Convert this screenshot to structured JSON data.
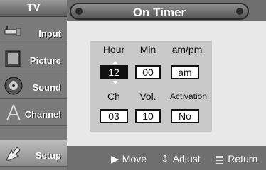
{
  "top": {
    "tab": "TV",
    "title": "On Timer"
  },
  "sidebar": {
    "items": [
      {
        "label": "Input",
        "icon": "input-icon"
      },
      {
        "label": "Picture",
        "icon": "picture-icon"
      },
      {
        "label": "Sound",
        "icon": "sound-icon"
      },
      {
        "label": "Channel",
        "icon": "channel-icon"
      },
      {
        "label": "Setup",
        "icon": "setup-icon"
      }
    ],
    "active": "Setup"
  },
  "timer": {
    "headers_row1": [
      "Hour",
      "Min",
      "am/pm"
    ],
    "values_row1": [
      "12",
      "00",
      "am"
    ],
    "headers_row2": [
      "Ch",
      "Vol.",
      "Activation"
    ],
    "values_row2": [
      "03",
      "10",
      "No"
    ]
  },
  "footer": {
    "move_label": "Move",
    "adjust_label": "Adjust",
    "return_label": "Return"
  }
}
